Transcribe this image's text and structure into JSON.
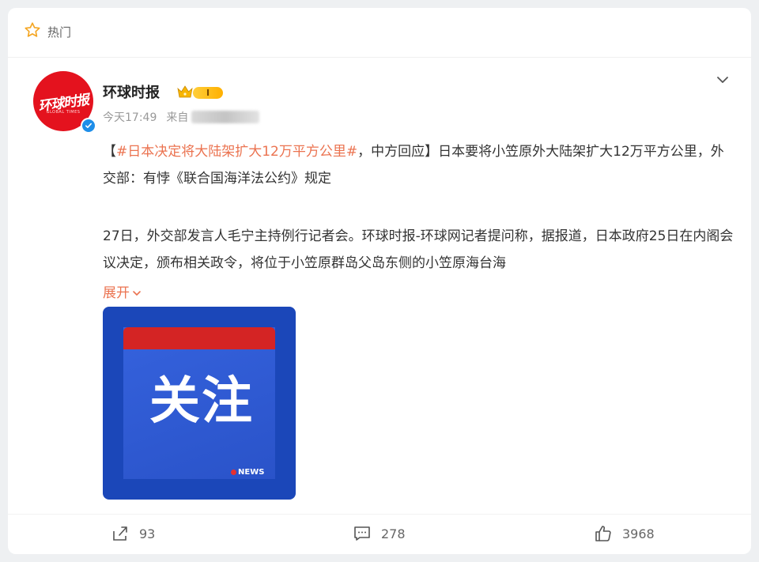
{
  "header": {
    "label": "热门"
  },
  "account": {
    "name": "环球时报",
    "avatar_text": "环球时报",
    "avatar_sub": "GLOBAL TIMES",
    "level": "I"
  },
  "meta": {
    "time": "今天17:49",
    "from_label": "来自"
  },
  "post": {
    "bracket_open": "【",
    "topic": "#日本决定将大陆架扩大12万平方公里#",
    "after_topic": "，中方回应】日本要将小笠原外大陆架扩大12万平方公里，外交部：有悖《联合国海洋法公约》规定",
    "para2": "27日，外交部发言人毛宁主持例行记者会。环球时报-环球网记者提问称，据报道，日本政府25日在内阁会议决定，颁布相关政令，将位于小笠原群岛父岛东侧的小笠原海台海",
    "expand": "展开"
  },
  "thumbnail": {
    "title": "关注",
    "news": "NEWS"
  },
  "actions": {
    "shares": "93",
    "comments": "278",
    "likes": "3968"
  },
  "colors": {
    "accent": "#eb7350",
    "verify": "#1e8ee9",
    "brand_red": "#e4121e",
    "thumb_blue": "#1b47b9"
  }
}
